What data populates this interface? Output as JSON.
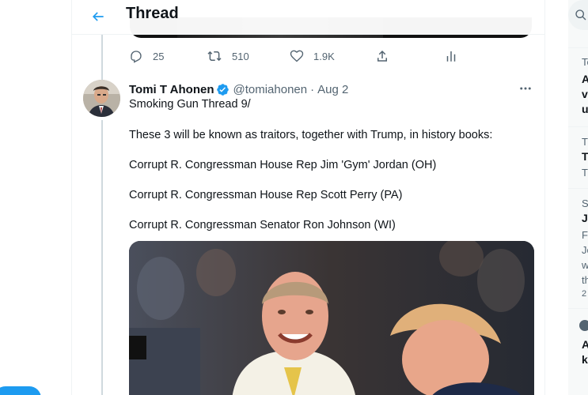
{
  "header": {
    "title": "Thread"
  },
  "previous_tweet": {
    "reply_count": "25",
    "retweet_count": "510",
    "like_count": "1.9K"
  },
  "tweet": {
    "author_name": "Tomi T Ahonen",
    "author_handle": "@tomiahonen",
    "separator": "·",
    "date": "Aug 2",
    "lines": [
      "Smoking Gun Thread 9/",
      "These 3 will be known as traitors, together with Trump, in history books:",
      "Corrupt R. Congressman House Rep Jim 'Gym' Jordan (OH)",
      "Corrupt R. Congressman House Rep Scott Perry (PA)",
      "Corrupt R. Congressman Senator Ron Johnson (WI)"
    ]
  },
  "right_column": {
    "fragments": [
      {
        "meta": "Te",
        "lines": [
          "A",
          "v",
          "u"
        ]
      },
      {
        "meta": "Tr",
        "lines": [
          "T",
          "T"
        ]
      },
      {
        "meta": "S",
        "lines": [
          "J",
          "F",
          "Jo",
          "w",
          "th",
          "2"
        ]
      },
      {
        "meta": "",
        "lines": [
          "A",
          "k"
        ]
      }
    ]
  },
  "colors": {
    "accent": "#1d9bf0",
    "text_primary": "#0f1419",
    "text_secondary": "#536471",
    "divider": "#eff3f4"
  },
  "icons": [
    "back-arrow-icon",
    "reply-icon",
    "retweet-icon",
    "like-icon",
    "share-icon",
    "analytics-icon",
    "verified-badge-icon",
    "more-icon",
    "search-icon"
  ]
}
